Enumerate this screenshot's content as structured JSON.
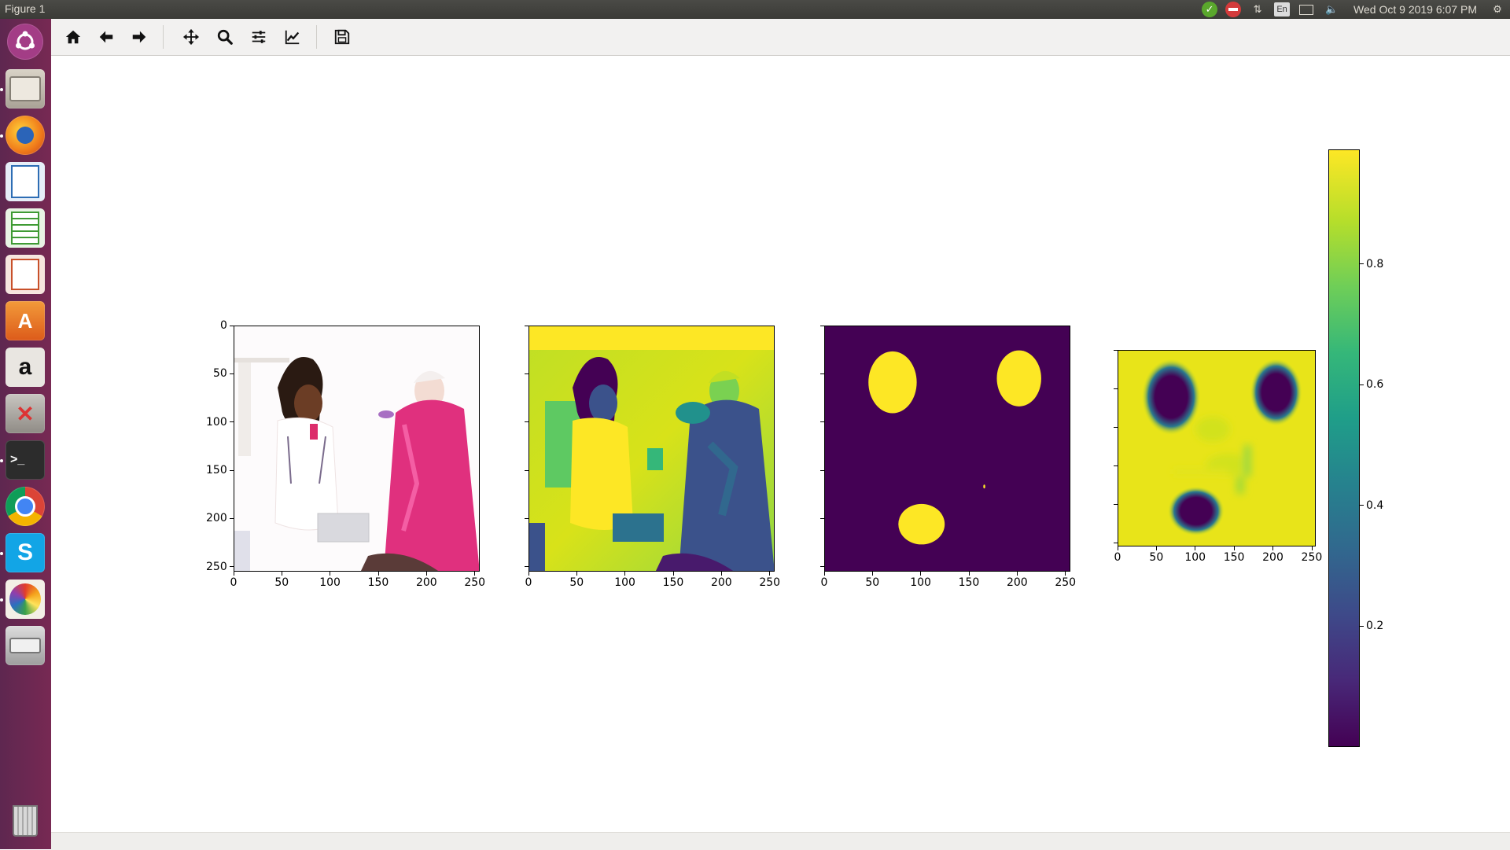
{
  "window": {
    "title": "Figure 1"
  },
  "tray": {
    "lang": "En",
    "clock": "Wed Oct  9 2019  6:07 PM"
  },
  "launcher": {
    "apps": [
      "ubuntu-dash",
      "files",
      "firefox",
      "libreoffice-writer",
      "libreoffice-calc",
      "libreoffice-impress",
      "software-center",
      "amazon",
      "system-settings",
      "terminal",
      "chrome",
      "skype",
      "pinwheel-app",
      "disk-drive",
      "trash"
    ]
  },
  "toolbar": {
    "buttons": [
      "home",
      "back",
      "forward",
      "pan",
      "zoom",
      "configure-subplots",
      "edit-axes",
      "save"
    ]
  },
  "colors": {
    "viridis_low": "#440154",
    "viridis_high": "#fde725",
    "magenta": "#e0307e"
  },
  "chart_data": [
    {
      "type": "heatmap",
      "name": "rgb-image",
      "xlim": [
        0,
        255
      ],
      "ylim": [
        255,
        0
      ],
      "xticks": [
        "0",
        "50",
        "100",
        "150",
        "200",
        "250"
      ],
      "yticks": [
        "0",
        "50",
        "100",
        "150",
        "200",
        "250"
      ]
    },
    {
      "type": "heatmap",
      "name": "grayscale-viridis",
      "xlim": [
        0,
        255
      ],
      "ylim": [
        255,
        0
      ],
      "xticks": [
        "0",
        "50",
        "100",
        "150",
        "200",
        "250"
      ]
    },
    {
      "type": "heatmap",
      "name": "ground-truth-mask",
      "xlim": [
        0,
        255
      ],
      "ylim": [
        255,
        0
      ],
      "xticks": [
        "0",
        "50",
        "100",
        "150",
        "200",
        "250"
      ],
      "blobs": [
        {
          "cx": 70,
          "cy": 58,
          "rx": 25,
          "ry": 32
        },
        {
          "cx": 201,
          "cy": 54,
          "rx": 23,
          "ry": 29
        },
        {
          "cx": 100,
          "cy": 205,
          "rx": 24,
          "ry": 21
        },
        {
          "cx": 165,
          "cy": 166,
          "rx": 1,
          "ry": 2
        }
      ]
    },
    {
      "type": "heatmap",
      "name": "predicted-map",
      "xlim": [
        0,
        255
      ],
      "ylim": [
        255,
        0
      ],
      "xticks": [
        "0",
        "50",
        "100",
        "150",
        "200",
        "250"
      ],
      "blobs": [
        {
          "cx": 68,
          "cy": 60,
          "rx": 26,
          "ry": 34
        },
        {
          "cx": 203,
          "cy": 54,
          "rx": 23,
          "ry": 30
        },
        {
          "cx": 100,
          "cy": 208,
          "rx": 25,
          "ry": 22
        }
      ]
    },
    {
      "type": "colorbar",
      "name": "colorbar",
      "range": [
        0.0,
        0.99
      ],
      "ticks": [
        "0.2",
        "0.4",
        "0.6",
        "0.8"
      ],
      "tick_values": [
        0.2,
        0.4,
        0.6,
        0.8
      ]
    }
  ]
}
